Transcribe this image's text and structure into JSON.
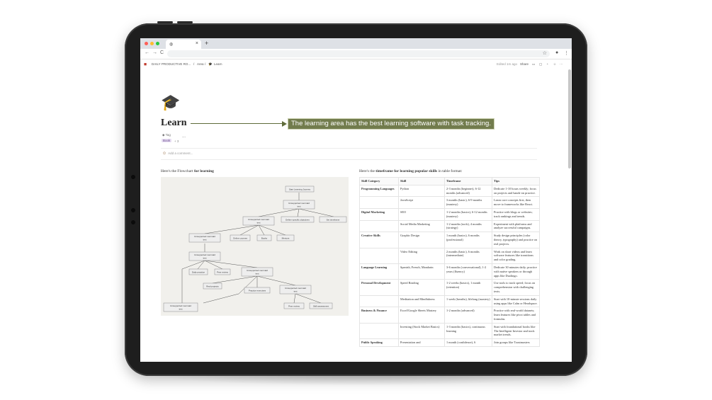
{
  "browser": {
    "tab_icon": "globe-icon",
    "tab_close": "×",
    "new_tab": "+",
    "back": "←",
    "forward": "→",
    "reload": "C",
    "star": "☆",
    "menu": "⋮"
  },
  "notion": {
    "breadcrumb": [
      "DAILY PRODUCTIVE RO...",
      "Area",
      "Learn"
    ],
    "breadcrumb_sep": "/",
    "edited": "Edited 1m ago",
    "share": "Share",
    "more": "···"
  },
  "page": {
    "icon": "graduation-cap-icon",
    "title": "Learn",
    "property_label": "Tag",
    "tag_value": "Book",
    "tag_plus": "+ 3",
    "more": "...",
    "add_comment": "Add a comment...",
    "flow_intro": "Here's the Flowchart ",
    "flow_intro_bold": "for learning",
    "table_intro": "Here's the ",
    "table_intro_bold": "timeframe for learning popular skills",
    "table_intro_end": " in table format:"
  },
  "callout": {
    "text": "The learning area has the best learning software with task tracking."
  },
  "flowchart": {
    "nodes": [
      {
        "label": "Start Learning Journey"
      },
      {
        "label": "Unsupported mermaid<br>text"
      },
      {
        "label": "Unsupported mermaid<br>text"
      },
      {
        "label": "Define specific objectives"
      },
      {
        "label": "Set timeframe"
      },
      {
        "label": "Unsupported mermaid<br>text"
      },
      {
        "label": "Online courses"
      },
      {
        "label": "Books"
      },
      {
        "label": "Mentors"
      },
      {
        "label": "Unsupported mermaid<br>text"
      },
      {
        "label": "Daily practice"
      },
      {
        "label": "Peer review"
      },
      {
        "label": "Unsupported mermaid<br>text"
      },
      {
        "label": "Real projects"
      },
      {
        "label": "Practice exercises"
      },
      {
        "label": "Unsupported mermaid<br>text"
      },
      {
        "label": "Unsupported mermaid<br>text"
      },
      {
        "label": "Peer review"
      },
      {
        "label": "Skill assessment"
      }
    ]
  },
  "table": {
    "headers": [
      "Skill Category",
      "Skill",
      "Timeframe",
      "Tips"
    ],
    "rows": [
      [
        "Programming Languages",
        "Python",
        "2-3 months (beginner), 6-12 months (advanced)",
        "Dedicate 1-10 hours weekly; focus on projects and hands-on practice."
      ],
      [
        "",
        "JavaScript",
        "3 months (basic), 6-9 months (mastery)",
        "Learn core concepts first, then move to frameworks like React."
      ],
      [
        "Digital Marketing",
        "SEO",
        "1-2 months (basics), 6-12 months (mastery)",
        "Practice with blogs or websites; track rankings and trends."
      ],
      [
        "",
        "Social Media Marketing",
        "1-2 months (tools), 4 months (strategy)",
        "Experiment with platforms and analyze successful campaigns."
      ],
      [
        "Creative Skills",
        "Graphic Design",
        "1 month (basics), 6 months (professional)",
        "Study design principles (color theory, typography) and practice on real projects."
      ],
      [
        "",
        "Video Editing",
        "2 months (basic), 6 months (intermediate)",
        "Work on short videos and learn software features like transitions and color grading."
      ],
      [
        "Language Learning",
        "Spanish, French, Mandarin",
        "3-6 months (conversational), 1-2 years (fluency)",
        "Dedicate 30 minutes daily; practice with native speakers or through apps like Duolingo."
      ],
      [
        "Personal Development",
        "Speed Reading",
        "1-2 weeks (basics), 1 month (retention)",
        "Use tools to track speed; focus on comprehension with challenging texts."
      ],
      [
        "",
        "Meditation and Mindfulness",
        "1 week (breaths), lifelong (mastery)",
        "Start with 10-minute sessions daily using apps like Calm or Headspace."
      ],
      [
        "Business & Finance",
        "Excel/Google Sheets Mastery",
        "1-2 months (advanced)",
        "Practice with real-world datasets; learn features like pivot tables and formulas."
      ],
      [
        "",
        "Investing (Stock Market Basics)",
        "1-3 months (basics), continuous learning",
        "Start with foundational books like The Intelligent Investor and track market trends."
      ],
      [
        "Public Speaking",
        "Presentation and",
        "1 month (confidence), 6",
        "Join groups like Toastmasters"
      ]
    ]
  }
}
